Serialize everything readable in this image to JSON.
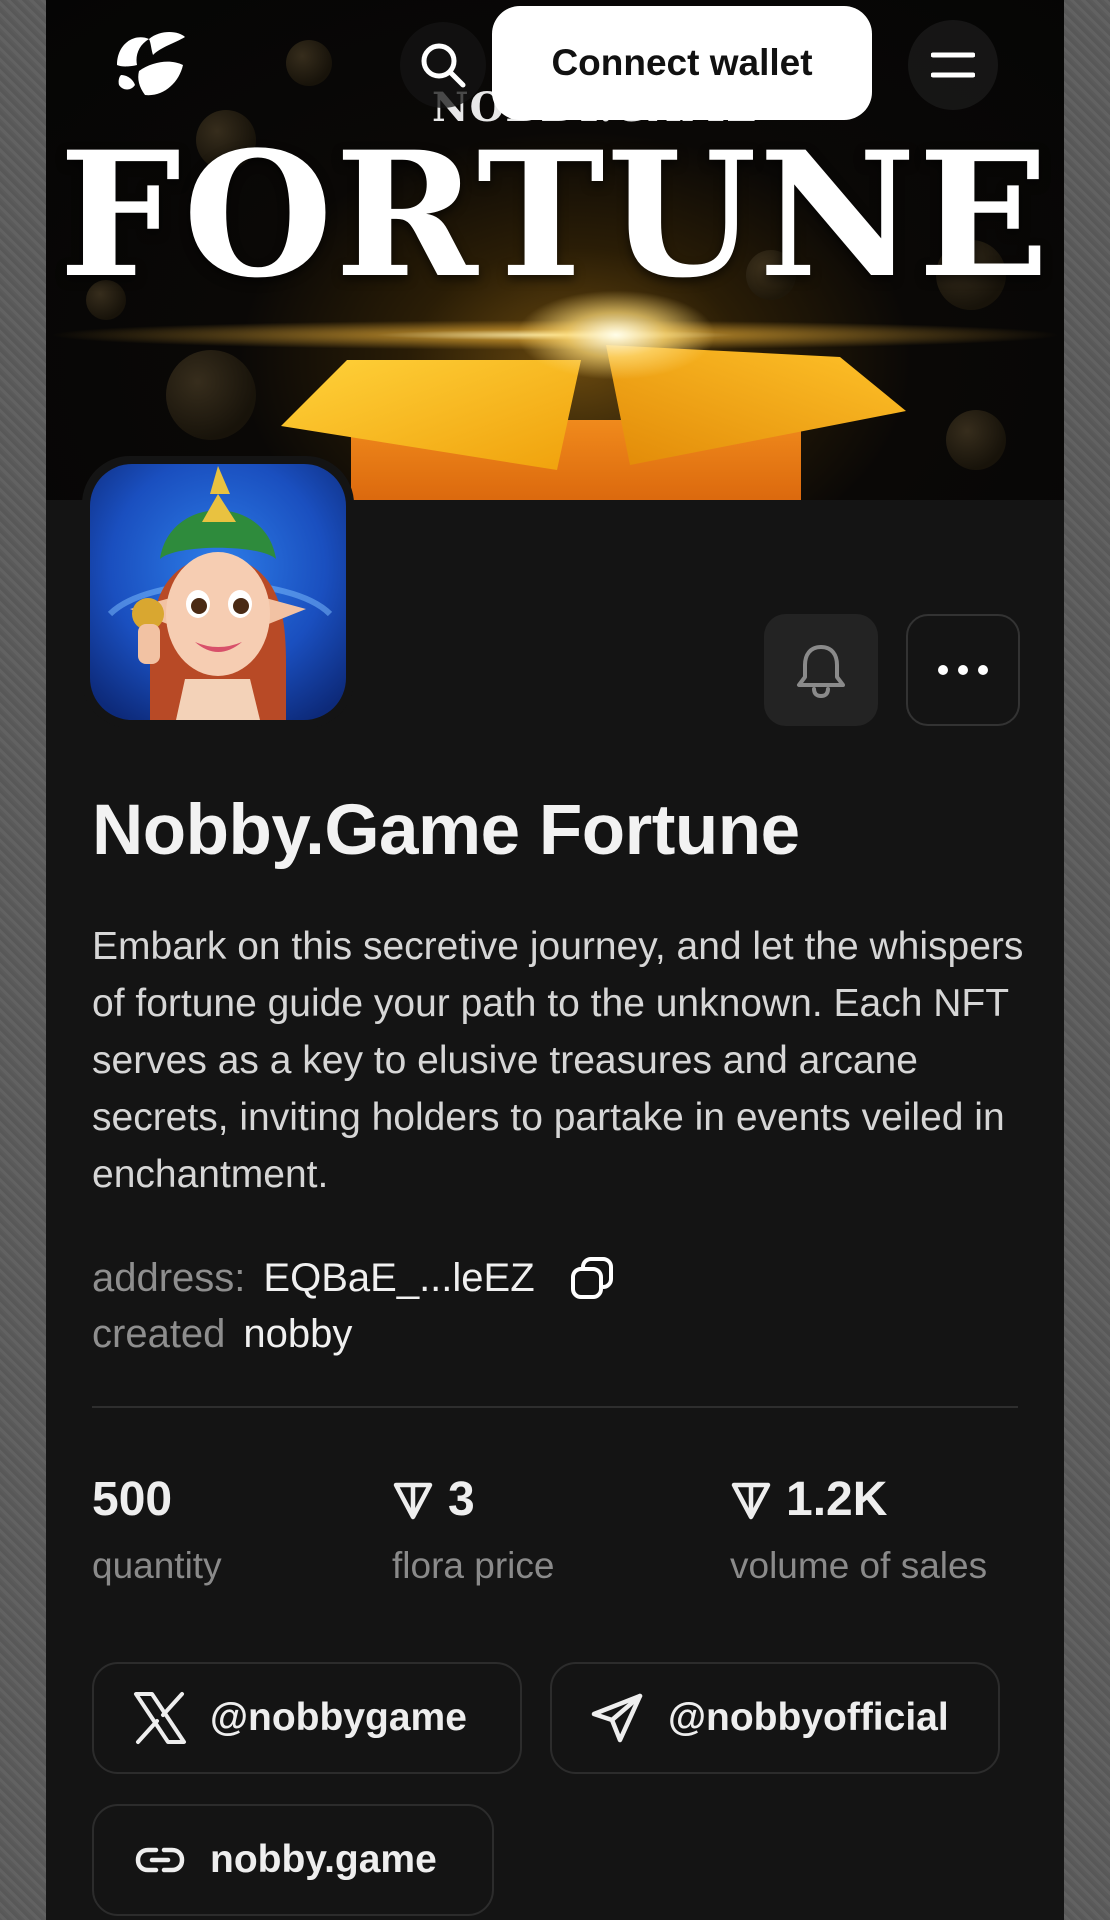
{
  "header": {
    "connect_wallet_label": "Connect wallet",
    "logo_icon": "brand-leaf-icon",
    "search_icon": "search-icon",
    "menu_icon": "menu-icon"
  },
  "banner": {
    "brand_text": "NOBBY.GAME",
    "title": "FORTUNE"
  },
  "collection": {
    "name": "Nobby.Game Fortune",
    "description": "Embark on this secretive journey, and let the whispers of fortune guide your path to the unknown. Each NFT serves as a key to elusive treasures and arcane secrets, inviting holders to partake in events veiled in enchantment.",
    "address_label": "address:",
    "address_value": "EQBaE_...leEZ",
    "created_label": "created",
    "created_value": "nobby"
  },
  "stats": [
    {
      "value": "500",
      "label": "quantity",
      "icon": ""
    },
    {
      "value": "3",
      "label": "flora price",
      "icon": "ton-icon"
    },
    {
      "value": "1.2K",
      "label": "volume of sales",
      "icon": "ton-icon"
    }
  ],
  "links": {
    "twitter": "@nobbygame",
    "telegram": "@nobbyofficial",
    "website": "nobby.game"
  },
  "colors": {
    "background": "#141414",
    "text_primary": "#f2f2f2",
    "text_muted": "#8e8e8e",
    "button_white": "#ffffff",
    "accent_gold": "#f5a623"
  }
}
